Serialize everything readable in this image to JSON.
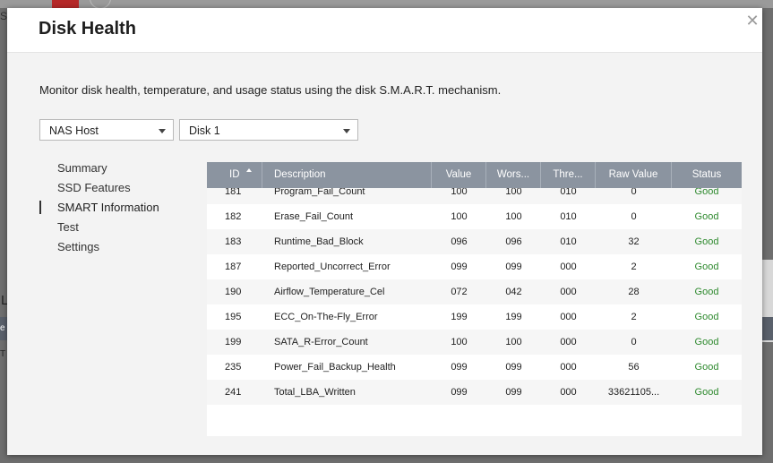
{
  "background": {
    "left_letters": [
      "S",
      "L",
      "e",
      "T"
    ]
  },
  "dialog": {
    "title": "Disk Health",
    "close_icon": "close-icon"
  },
  "description": "Monitor disk health, temperature, and usage status using the disk S.M.A.R.T. mechanism.",
  "selectors": {
    "host": "NAS Host",
    "disk": "Disk 1"
  },
  "nav": {
    "items": [
      {
        "label": "Summary",
        "active": false
      },
      {
        "label": "SSD Features",
        "active": false
      },
      {
        "label": "SMART Information",
        "active": true
      },
      {
        "label": "Test",
        "active": false
      },
      {
        "label": "Settings",
        "active": false
      }
    ]
  },
  "table": {
    "headers": {
      "id": "ID",
      "description": "Description",
      "value": "Value",
      "worst": "Wors...",
      "threshold": "Thre...",
      "raw": "Raw Value",
      "status": "Status"
    },
    "status_color": "#2f8a2f",
    "rows": [
      {
        "id": "181",
        "description": "Program_Fail_Count",
        "value": "100",
        "worst": "100",
        "threshold": "010",
        "raw": "0",
        "status": "Good"
      },
      {
        "id": "182",
        "description": "Erase_Fail_Count",
        "value": "100",
        "worst": "100",
        "threshold": "010",
        "raw": "0",
        "status": "Good"
      },
      {
        "id": "183",
        "description": "Runtime_Bad_Block",
        "value": "096",
        "worst": "096",
        "threshold": "010",
        "raw": "32",
        "status": "Good"
      },
      {
        "id": "187",
        "description": "Reported_Uncorrect_Error",
        "value": "099",
        "worst": "099",
        "threshold": "000",
        "raw": "2",
        "status": "Good"
      },
      {
        "id": "190",
        "description": "Airflow_Temperature_Cel",
        "value": "072",
        "worst": "042",
        "threshold": "000",
        "raw": "28",
        "status": "Good"
      },
      {
        "id": "195",
        "description": "ECC_On-The-Fly_Error",
        "value": "199",
        "worst": "199",
        "threshold": "000",
        "raw": "2",
        "status": "Good"
      },
      {
        "id": "199",
        "description": "SATA_R-Error_Count",
        "value": "100",
        "worst": "100",
        "threshold": "000",
        "raw": "0",
        "status": "Good"
      },
      {
        "id": "235",
        "description": "Power_Fail_Backup_Health",
        "value": "099",
        "worst": "099",
        "threshold": "000",
        "raw": "56",
        "status": "Good"
      },
      {
        "id": "241",
        "description": "Total_LBA_Written",
        "value": "099",
        "worst": "099",
        "threshold": "000",
        "raw": "33621105...",
        "status": "Good"
      }
    ]
  }
}
